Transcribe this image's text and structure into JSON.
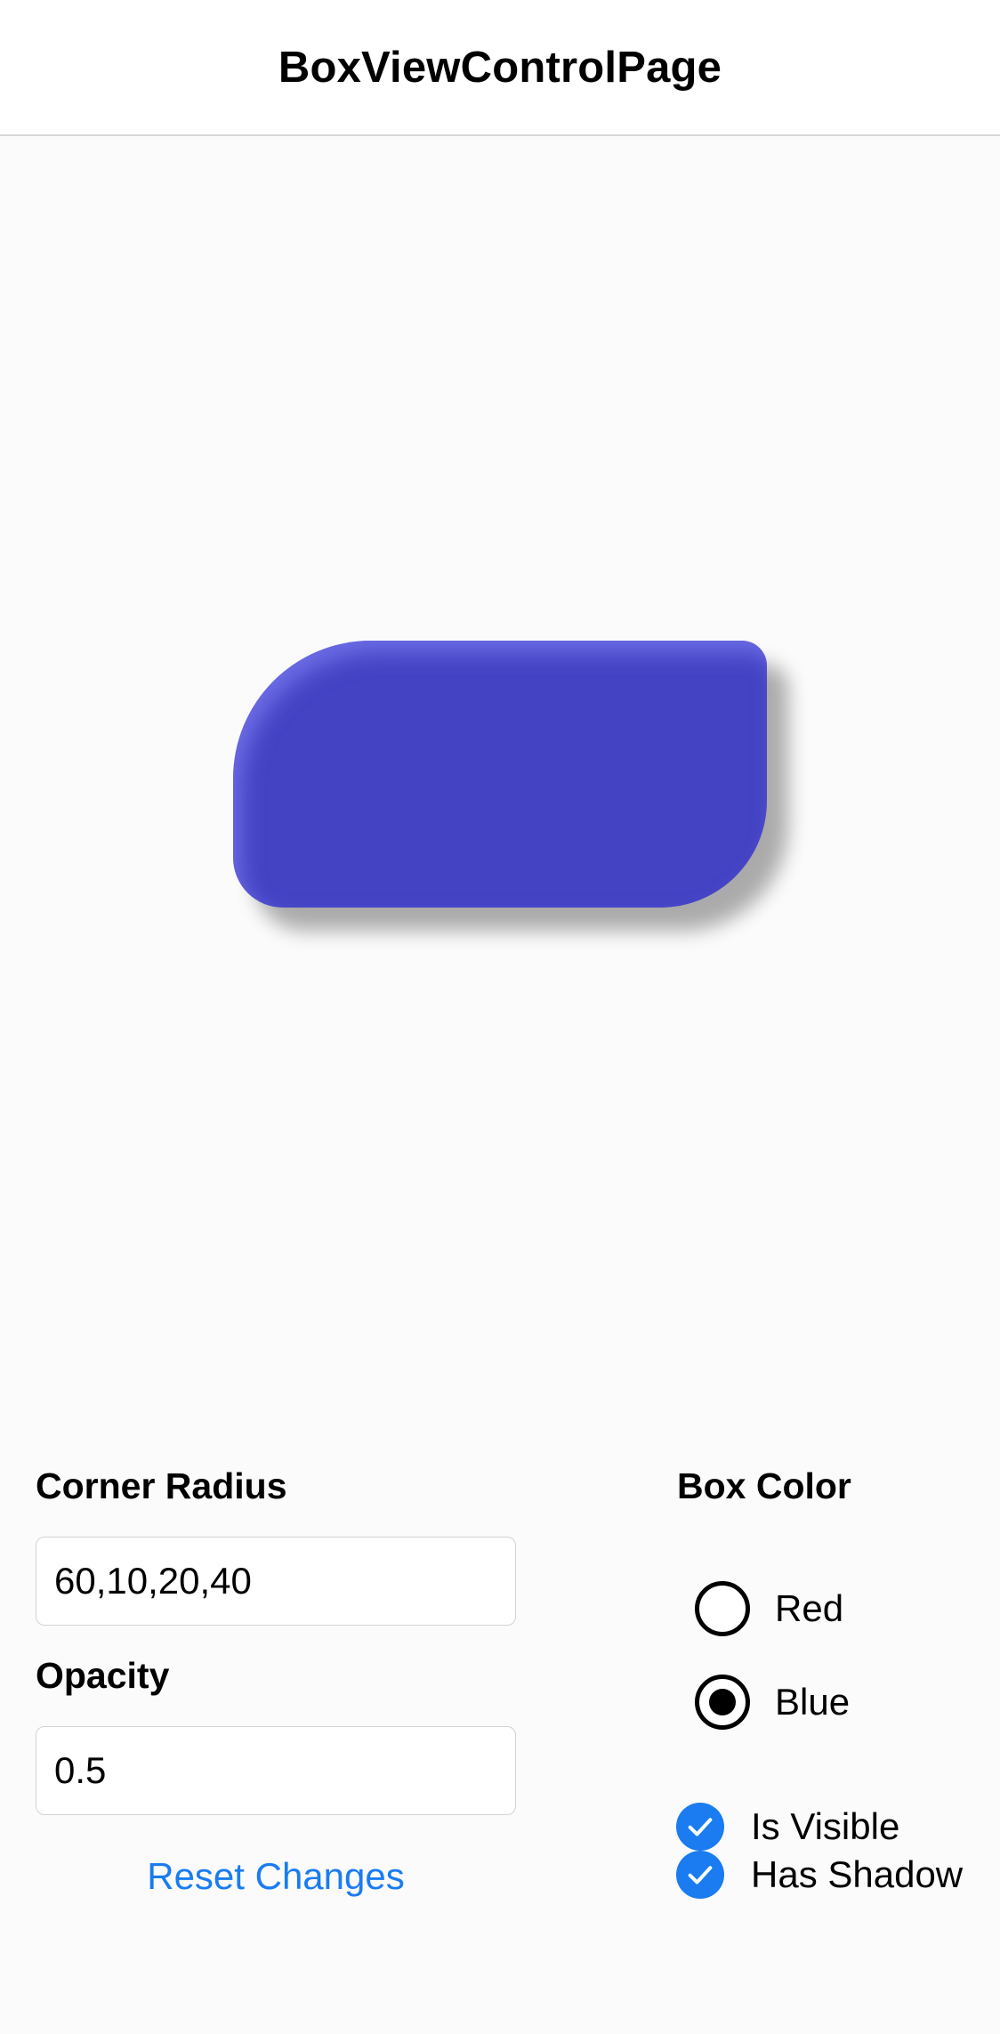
{
  "page": {
    "title": "BoxViewControlPage"
  },
  "controls": {
    "corner_radius_label": "Corner Radius",
    "corner_radius_value": "60,10,20,40",
    "opacity_label": "Opacity",
    "opacity_value": "0.5",
    "reset_label": "Reset Changes",
    "box_color_label": "Box Color",
    "color_options": [
      {
        "label": "Red",
        "selected": false
      },
      {
        "label": "Blue",
        "selected": true
      }
    ],
    "checkboxes": [
      {
        "label": "Is Visible",
        "checked": true
      },
      {
        "label": "Has Shadow",
        "checked": true
      }
    ]
  },
  "colors": {
    "box_fill": "#4343c4",
    "accent": "#1a7cf0"
  }
}
